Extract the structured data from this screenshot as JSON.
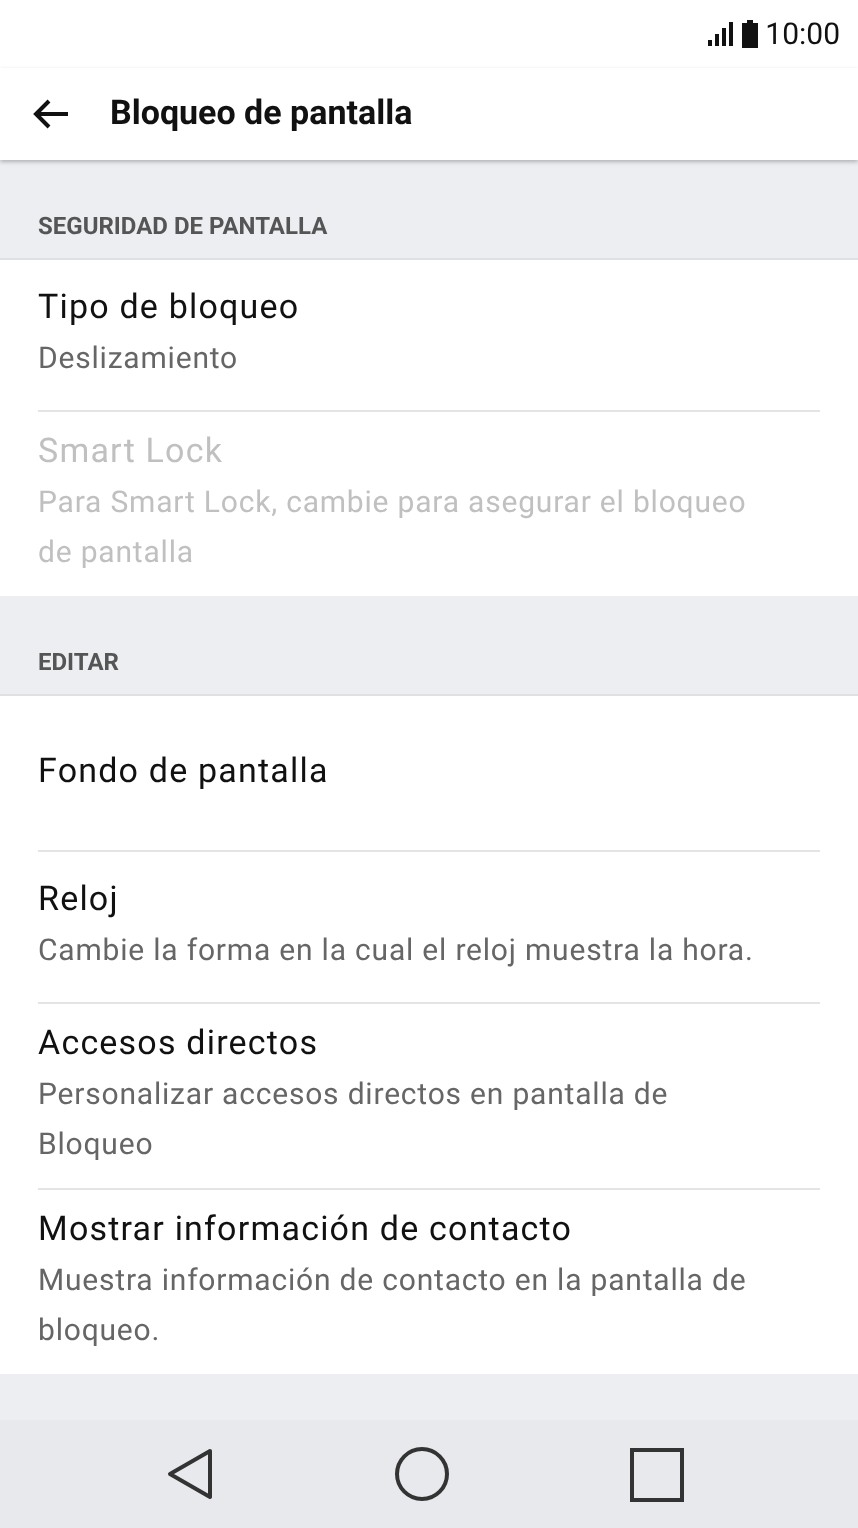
{
  "status_bar": {
    "time": "10:00"
  },
  "toolbar": {
    "title": "Bloqueo de pantalla"
  },
  "sections": [
    {
      "header": "SEGURIDAD DE PANTALLA",
      "items": [
        {
          "title": "Tipo de bloqueo",
          "summary": "Deslizamiento",
          "disabled": false
        },
        {
          "title": "Smart Lock",
          "summary": "Para Smart Lock, cambie para asegurar el bloqueo de pantalla",
          "disabled": true
        }
      ]
    },
    {
      "header": "EDITAR",
      "items": [
        {
          "title": "Fondo de pantalla",
          "disabled": false
        },
        {
          "title": "Reloj",
          "summary": "Cambie la forma en la cual el reloj muestra la hora.",
          "disabled": false
        },
        {
          "title": "Accesos directos",
          "summary": "Personalizar accesos directos en pantalla de Bloqueo",
          "disabled": false
        },
        {
          "title": "Mostrar información de contacto",
          "summary": "Muestra información de contacto en la pantalla de bloqueo.",
          "disabled": false
        }
      ]
    }
  ]
}
